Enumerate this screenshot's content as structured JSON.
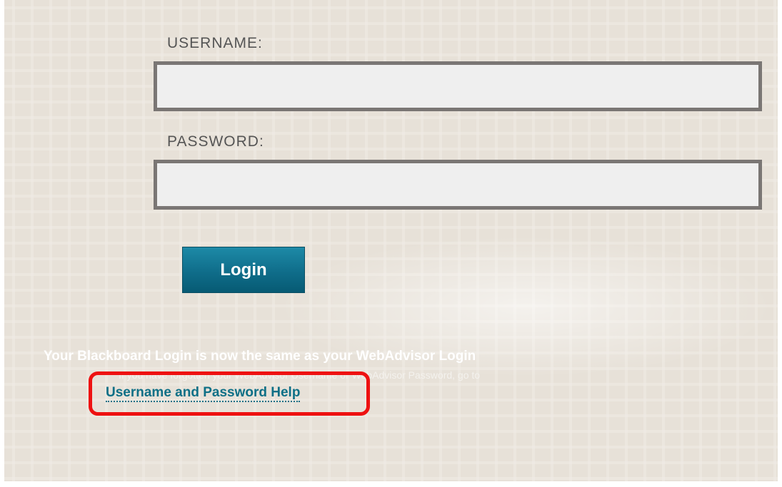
{
  "login_form": {
    "username_label": "USERNAME:",
    "username_value": "",
    "password_label": "PASSWORD:",
    "password_value": "",
    "login_button_label": "Login"
  },
  "notice": {
    "headline": "Your Blackboard Login is now the same as your WebAdvisor Login",
    "subtext": "If you have forgotten your WebAdvisor Username or WebAdvisor Password, go to",
    "help_link_label": "Username and Password Help"
  },
  "colors": {
    "background": "#ece8e1",
    "input_border": "#7a7674",
    "input_fill": "#efefef",
    "button": "#0f6d8a",
    "link": "#0d6f86",
    "annotation_highlight": "#ee1111"
  }
}
